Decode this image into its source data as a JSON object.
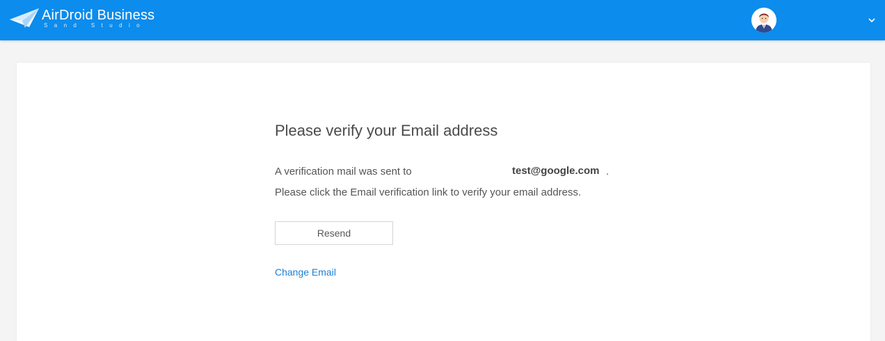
{
  "header": {
    "brand_name": "AirDroid Business",
    "brand_subtitle": "Sand Studio",
    "accent_color": "#0c8cec"
  },
  "user_menu": {
    "avatar_icon": "user-avatar-icon",
    "dropdown_icon": "chevron-down-icon"
  },
  "verify": {
    "title": "Please verify your Email address",
    "sent_text": "A verification mail was sent to",
    "email": "test@google.com",
    "period": ".",
    "instruction": "Please click the Email verification link to verify your email address.",
    "resend_label": "Resend",
    "change_email_label": "Change Email",
    "link_color": "#1a7fd4"
  }
}
